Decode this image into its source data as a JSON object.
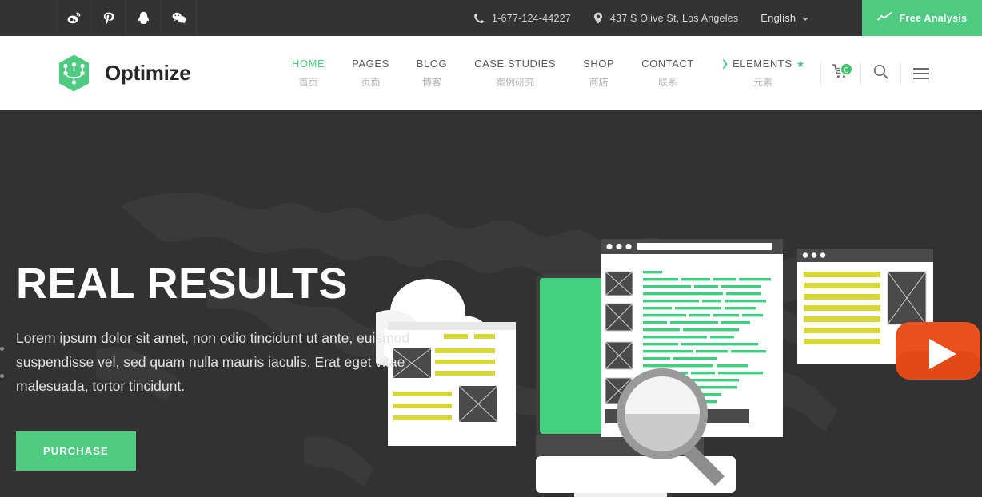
{
  "topbar": {
    "social": [
      {
        "name": "weibo-icon",
        "label": "Weibo"
      },
      {
        "name": "pinterest-icon",
        "label": "Pinterest"
      },
      {
        "name": "qq-icon",
        "label": "QQ"
      },
      {
        "name": "wechat-icon",
        "label": "WeChat"
      }
    ],
    "phone": "1-677-124-44227",
    "address": "437 S Olive St, Los Angeles",
    "language": "English",
    "cta_label": "Free Analysis"
  },
  "header": {
    "brand": "Optimize",
    "nav": [
      {
        "en": "HOME",
        "cn": "首页",
        "active": true,
        "chevron": false,
        "star": false
      },
      {
        "en": "PAGES",
        "cn": "页面",
        "active": false,
        "chevron": false,
        "star": false
      },
      {
        "en": "BLOG",
        "cn": "博客",
        "active": false,
        "chevron": false,
        "star": false
      },
      {
        "en": "CASE STUDIES",
        "cn": "案例研究",
        "active": false,
        "chevron": false,
        "star": false
      },
      {
        "en": "SHOP",
        "cn": "商店",
        "active": false,
        "chevron": false,
        "star": false
      },
      {
        "en": "CONTACT",
        "cn": "联系",
        "active": false,
        "chevron": false,
        "star": false
      },
      {
        "en": "ELEMENTS",
        "cn": "元素",
        "active": false,
        "chevron": true,
        "star": true
      }
    ],
    "cart_count": "0",
    "tools": [
      "cart-icon",
      "search-icon",
      "menu-icon"
    ]
  },
  "hero": {
    "title": "REAL RESULTS",
    "subtitle": "Lorem ipsum dolor sit amet, non odio tincidunt ut ante, euismod suspendisse vel, sed quam nulla mauris iaculis. Erat eget vitae malesuada, tortor tincidunt.",
    "button_label": "PURCHASE",
    "slide_count": 2,
    "active_slide": 1
  },
  "colors": {
    "accent_green": "#4ecb80",
    "topbar_dark": "#333333",
    "hero_dark": "#323232",
    "play_orange": "#e8511d",
    "doc_yellow": "#d8d73a",
    "code_green": "#3fcf7f",
    "header_white": "#ffffff"
  }
}
